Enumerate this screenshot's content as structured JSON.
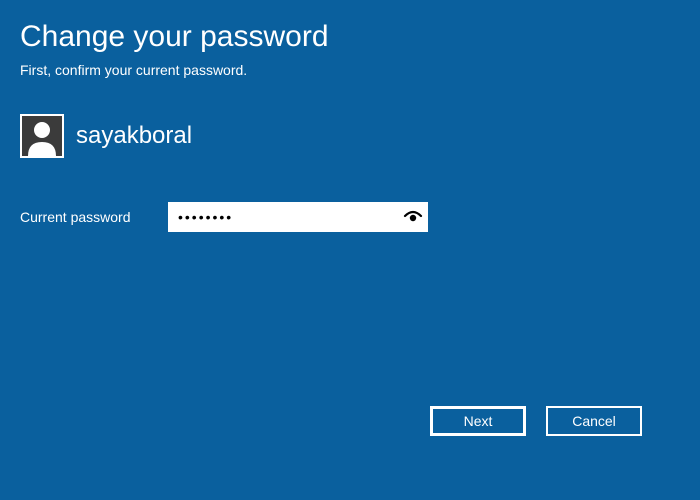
{
  "title": "Change your password",
  "subtitle": "First, confirm your current password.",
  "user": {
    "name": "sayakboral"
  },
  "form": {
    "current_password_label": "Current password",
    "current_password_value": "••••••••"
  },
  "buttons": {
    "next": "Next",
    "cancel": "Cancel"
  },
  "icons": {
    "avatar": "user-avatar-icon",
    "reveal": "password-reveal-eye-icon"
  },
  "colors": {
    "background": "#0a609e",
    "text": "#ffffff",
    "input_bg": "#ffffff"
  }
}
